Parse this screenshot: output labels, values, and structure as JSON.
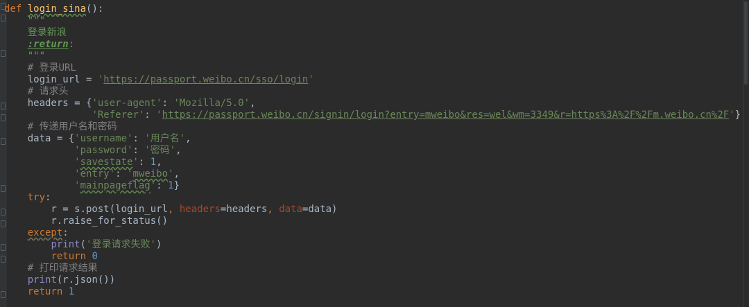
{
  "editor": {
    "theme_colors": {
      "background": "#2b2b2b",
      "keyword": "#cc7832",
      "function_name": "#ffc66d",
      "string": "#6a8759",
      "docstring": "#629755",
      "comment": "#808080",
      "number": "#6897bb",
      "parameter": "#aa4926",
      "builtin": "#8888c6",
      "default_text": "#a9b7c6"
    },
    "lines": [
      {
        "tokens": [
          {
            "t": "def",
            "c": "kw"
          },
          {
            "t": " "
          },
          {
            "t": "login_sina",
            "c": "fn",
            "u": "typo"
          },
          {
            "t": "():"
          }
        ]
      },
      {
        "tokens": [
          {
            "t": "    "
          },
          {
            "t": "\"\"\"",
            "c": "doc"
          }
        ]
      },
      {
        "tokens": [
          {
            "t": "    "
          },
          {
            "t": "登录新浪",
            "c": "doc"
          }
        ]
      },
      {
        "tokens": [
          {
            "t": "    "
          },
          {
            "t": ":return",
            "c": "doctag"
          },
          {
            "t": ":",
            "c": "doc"
          }
        ]
      },
      {
        "tokens": [
          {
            "t": "    "
          },
          {
            "t": "\"\"\"",
            "c": "doc"
          }
        ]
      },
      {
        "tokens": [
          {
            "t": "    "
          },
          {
            "t": "# 登录URL",
            "c": "com"
          }
        ]
      },
      {
        "tokens": [
          {
            "t": "    login_url = "
          },
          {
            "t": "'",
            "c": "str"
          },
          {
            "t": "https://passport.weibo.cn/sso/login",
            "c": "str",
            "u": "link"
          },
          {
            "t": "'",
            "c": "str"
          }
        ]
      },
      {
        "tokens": [
          {
            "t": "    "
          },
          {
            "t": "# 请求头",
            "c": "com"
          }
        ]
      },
      {
        "tokens": [
          {
            "t": "    headers = {"
          },
          {
            "t": "'user-agent'",
            "c": "str"
          },
          {
            "t": ": "
          },
          {
            "t": "'Mozilla/5.0'",
            "c": "str"
          },
          {
            "t": ","
          }
        ]
      },
      {
        "tokens": [
          {
            "t": "               "
          },
          {
            "t": "'Referer'",
            "c": "str"
          },
          {
            "t": ": "
          },
          {
            "t": "'",
            "c": "str"
          },
          {
            "t": "https://passport.weibo.cn/signin/login?entry=mweibo&res=wel&wm=3349&r=https%3A%2F%2Fm.weibo.cn%2F",
            "c": "str",
            "u": "link"
          },
          {
            "t": "'",
            "c": "str"
          },
          {
            "t": "}"
          }
        ]
      },
      {
        "tokens": [
          {
            "t": "    "
          },
          {
            "t": "# 传递用户名和密码",
            "c": "com"
          }
        ]
      },
      {
        "tokens": [
          {
            "t": "    data = {"
          },
          {
            "t": "'username'",
            "c": "str"
          },
          {
            "t": ": "
          },
          {
            "t": "'用户名'",
            "c": "str"
          },
          {
            "t": ","
          }
        ]
      },
      {
        "tokens": [
          {
            "t": "            "
          },
          {
            "t": "'password'",
            "c": "str"
          },
          {
            "t": ": "
          },
          {
            "t": "'密码'",
            "c": "str"
          },
          {
            "t": ","
          }
        ]
      },
      {
        "tokens": [
          {
            "t": "            "
          },
          {
            "t": "'",
            "c": "str"
          },
          {
            "t": "savestate",
            "c": "str",
            "u": "typo"
          },
          {
            "t": "'",
            "c": "str"
          },
          {
            "t": ": "
          },
          {
            "t": "1",
            "c": "num"
          },
          {
            "t": ","
          }
        ]
      },
      {
        "tokens": [
          {
            "t": "            "
          },
          {
            "t": "'entry'",
            "c": "str"
          },
          {
            "t": ": "
          },
          {
            "t": "'",
            "c": "str"
          },
          {
            "t": "mweibo",
            "c": "str",
            "u": "typo"
          },
          {
            "t": "'",
            "c": "str"
          },
          {
            "t": ","
          }
        ]
      },
      {
        "tokens": [
          {
            "t": "            "
          },
          {
            "t": "'",
            "c": "str"
          },
          {
            "t": "mainpageflag",
            "c": "str",
            "u": "typo"
          },
          {
            "t": "'",
            "c": "str"
          },
          {
            "t": ": "
          },
          {
            "t": "1",
            "c": "num"
          },
          {
            "t": "}"
          }
        ]
      },
      {
        "tokens": [
          {
            "t": "    "
          },
          {
            "t": "try",
            "c": "kw"
          },
          {
            "t": ":"
          }
        ]
      },
      {
        "tokens": [
          {
            "t": "        r = s.post(login_url"
          },
          {
            "t": ", ",
            "c": "kw"
          },
          {
            "t": "headers",
            "c": "param"
          },
          {
            "t": "=headers"
          },
          {
            "t": ", ",
            "c": "kw"
          },
          {
            "t": "data",
            "c": "param"
          },
          {
            "t": "=data)"
          }
        ]
      },
      {
        "tokens": [
          {
            "t": "        r.raise_for_status()"
          }
        ]
      },
      {
        "tokens": [
          {
            "t": "    "
          },
          {
            "t": "except",
            "c": "kw",
            "u": "typo-w"
          },
          {
            "t": ":"
          }
        ]
      },
      {
        "tokens": [
          {
            "t": "        "
          },
          {
            "t": "print",
            "c": "builtin"
          },
          {
            "t": "("
          },
          {
            "t": "'登录请求失败'",
            "c": "str"
          },
          {
            "t": ")"
          }
        ]
      },
      {
        "tokens": [
          {
            "t": "        "
          },
          {
            "t": "return ",
            "c": "kw"
          },
          {
            "t": "0",
            "c": "num"
          }
        ]
      },
      {
        "tokens": [
          {
            "t": "    "
          },
          {
            "t": "# 打印请求结果",
            "c": "com"
          }
        ]
      },
      {
        "tokens": [
          {
            "t": "    "
          },
          {
            "t": "print",
            "c": "builtin"
          },
          {
            "t": "(r.json())"
          }
        ]
      },
      {
        "tokens": [
          {
            "t": "    "
          },
          {
            "t": "return ",
            "c": "kw"
          },
          {
            "t": "1",
            "c": "num"
          }
        ]
      }
    ]
  }
}
